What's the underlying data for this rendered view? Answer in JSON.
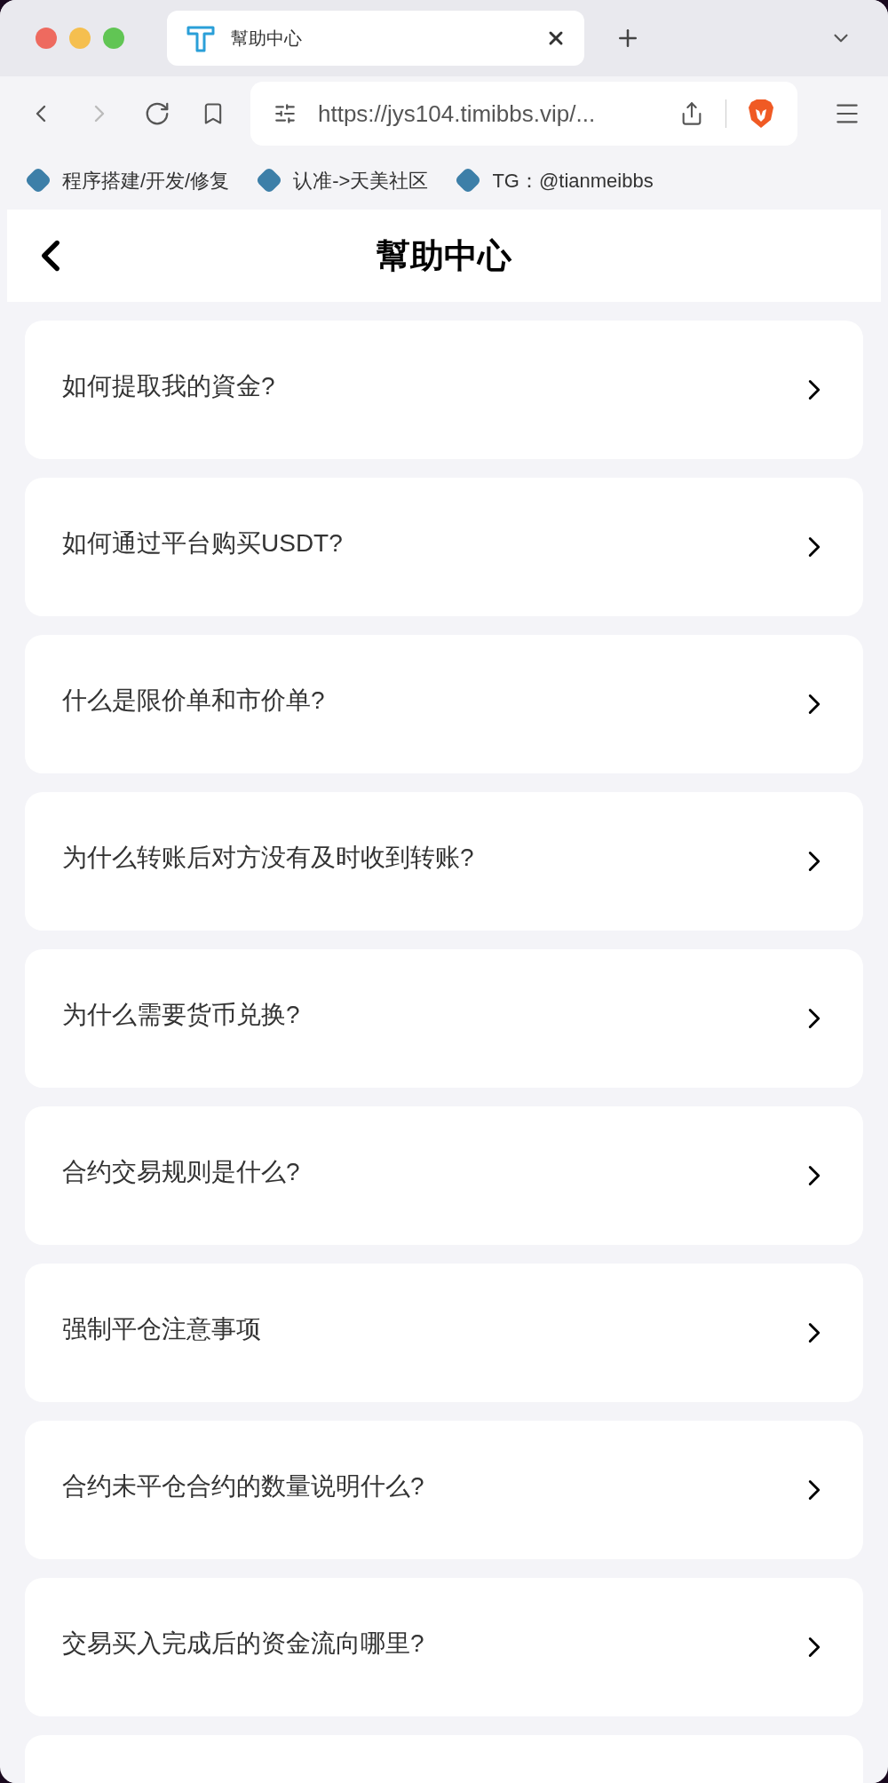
{
  "browser": {
    "tab": {
      "title": "幫助中心"
    },
    "url": "https://jys104.timibbs.vip/...",
    "bookmarks": [
      "程序搭建/开发/修复",
      "认准->天美社区",
      "TG：@tianmeibbs"
    ]
  },
  "header": {
    "title": "幫助中心"
  },
  "faq": [
    {
      "question": "如何提取我的資金?"
    },
    {
      "question": "如何通过平台购买USDT?"
    },
    {
      "question": "什么是限价单和市价单?"
    },
    {
      "question": "为什么转账后对方没有及时收到转账?"
    },
    {
      "question": "为什么需要货币兑换?"
    },
    {
      "question": "合约交易规则是什么?"
    },
    {
      "question": "强制平仓注意事项"
    },
    {
      "question": "合约未平仓合约的数量说明什么?"
    },
    {
      "question": "交易买入完成后的资金流向哪里?"
    }
  ]
}
